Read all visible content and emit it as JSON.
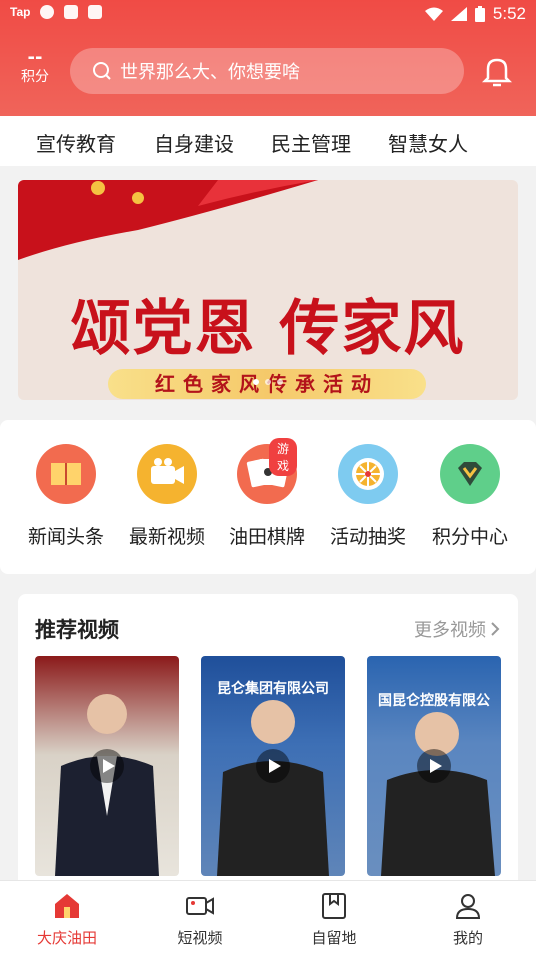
{
  "statusbar": {
    "left_label": "Tap",
    "time": "5:52"
  },
  "header": {
    "points_value": "--",
    "points_label": "积分",
    "search_placeholder": "世界那么大、你想要啥"
  },
  "tabs": [
    "宣传教育",
    "自身建设",
    "民主管理",
    "智慧女人"
  ],
  "banner": {
    "headline": "颂党恩 传家风",
    "ribbon": "红色家风传承活动"
  },
  "quick_items": [
    {
      "label": "新闻头条",
      "icon": "book-icon",
      "color": "#f26b4f"
    },
    {
      "label": "最新视频",
      "icon": "video-camera-icon",
      "color": "#f5b32f"
    },
    {
      "label": "油田棋牌",
      "icon": "playing-cards-icon",
      "color": "#f26b4f",
      "badge": "游戏"
    },
    {
      "label": "活动抽奖",
      "icon": "prize-wheel-icon",
      "color": "#7ecbf0"
    },
    {
      "label": "积分中心",
      "icon": "diamond-icon",
      "color": "#5fcf8a"
    }
  ],
  "recommend": {
    "title": "推荐视频",
    "more": "更多视频",
    "videos": [
      {
        "caption": ""
      },
      {
        "caption": "昆仑集团有限公司"
      },
      {
        "caption": "国昆仑控股有限公"
      }
    ]
  },
  "bottom_nav": [
    {
      "label": "大庆油田",
      "icon": "home-icon",
      "active": true
    },
    {
      "label": "短视频",
      "icon": "short-video-icon",
      "active": false
    },
    {
      "label": "自留地",
      "icon": "bookmark-icon",
      "active": false
    },
    {
      "label": "我的",
      "icon": "user-icon",
      "active": false
    }
  ],
  "colors": {
    "brand": "#f04b45",
    "active_nav": "#e53935"
  }
}
